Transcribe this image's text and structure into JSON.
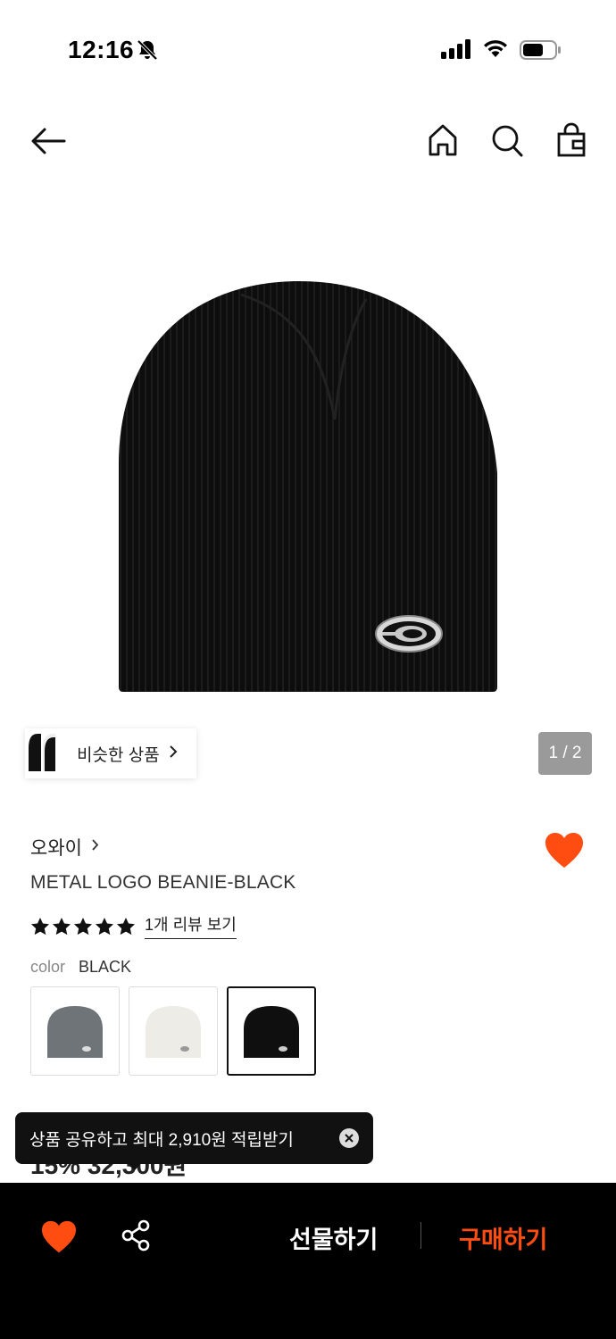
{
  "status_bar": {
    "time": "12:16"
  },
  "icons": {
    "back": "arrow-left-icon",
    "home": "home-icon",
    "search": "search-icon",
    "cart": "shopping-bag-icon",
    "wishlist": "heart-icon",
    "share": "share-icon",
    "close": "close-icon"
  },
  "gallery": {
    "similar_label": "비슷한 상품",
    "page_indicator": "1 / 2"
  },
  "product": {
    "brand": "오와이",
    "title": "METAL LOGO BEANIE-BLACK",
    "rating_stars": 5,
    "review_link": "1개 리뷰 보기",
    "color_label": "color",
    "color_value": "BLACK",
    "swatches": [
      "gray",
      "white",
      "black"
    ],
    "selected_swatch": "black",
    "price_peek": "15% 32,300원"
  },
  "toast": {
    "text": "상품 공유하고 최대 2,910원 적립받기"
  },
  "bottom_bar": {
    "gift_label": "선물하기",
    "buy_label": "구매하기"
  },
  "colors": {
    "accent": "#ff4d12",
    "toast_bg": "#111111",
    "bottom_bg": "#000000",
    "indicator_bg": "#9a9a9a"
  }
}
